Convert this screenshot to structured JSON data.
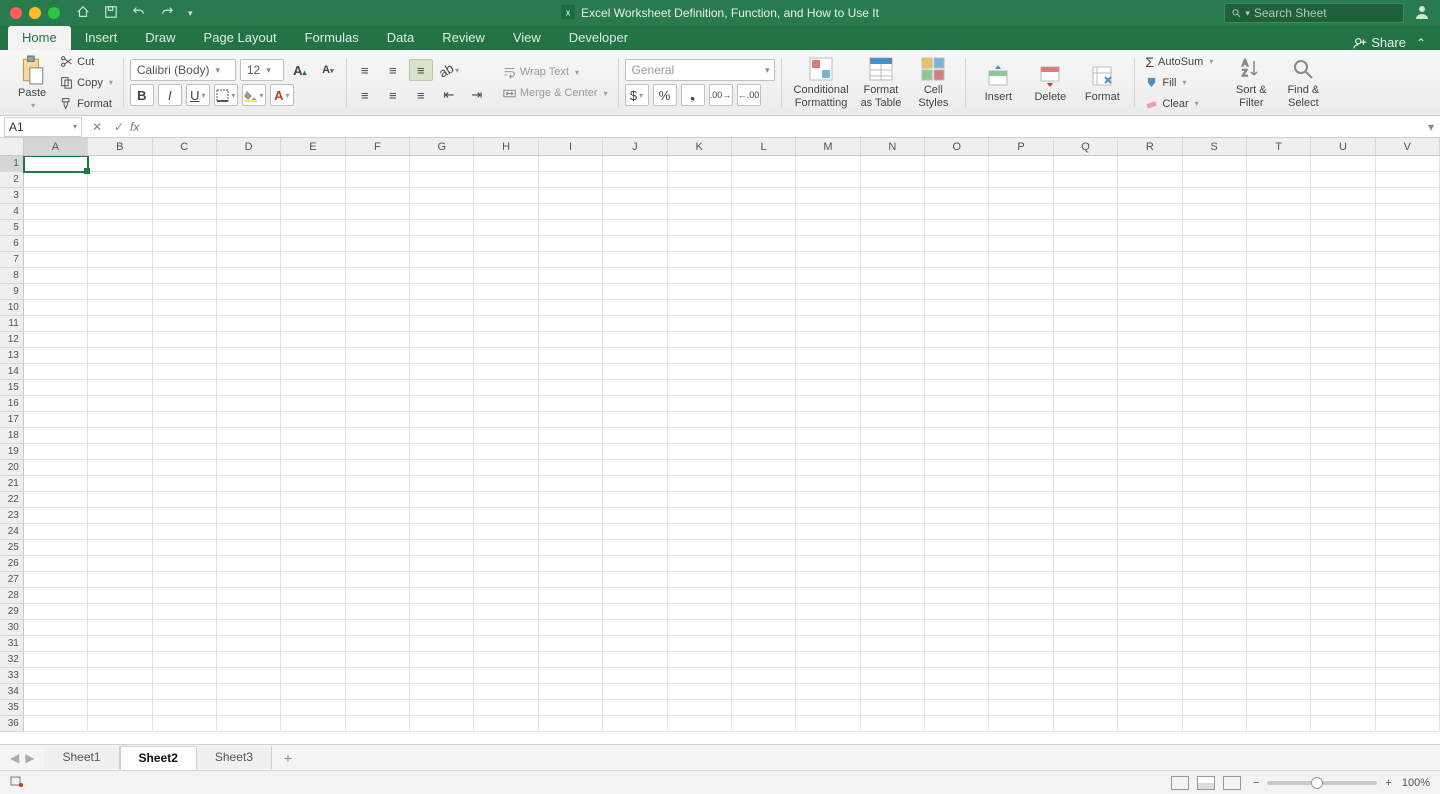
{
  "window_title": "Excel Worksheet Definition, Function, and How to Use It",
  "search_placeholder": "Search Sheet",
  "tabs": [
    "Home",
    "Insert",
    "Draw",
    "Page Layout",
    "Formulas",
    "Data",
    "Review",
    "View",
    "Developer"
  ],
  "active_tab": "Home",
  "share_label": "Share",
  "clipboard": {
    "paste": "Paste",
    "cut": "Cut",
    "copy": "Copy",
    "format": "Format"
  },
  "font": {
    "name": "Calibri (Body)",
    "size": "12"
  },
  "alignment": {
    "wrap": "Wrap Text",
    "merge": "Merge & Center"
  },
  "number_format": "General",
  "styles": {
    "conditional": "Conditional\nFormatting",
    "table": "Format\nas Table",
    "cell": "Cell\nStyles"
  },
  "cells": {
    "insert": "Insert",
    "delete": "Delete",
    "format": "Format"
  },
  "editing": {
    "autosum": "AutoSum",
    "fill": "Fill",
    "clear": "Clear",
    "sort": "Sort &\nFilter",
    "find": "Find &\nSelect"
  },
  "name_box": "A1",
  "columns": [
    "A",
    "B",
    "C",
    "D",
    "E",
    "F",
    "G",
    "H",
    "I",
    "J",
    "K",
    "L",
    "M",
    "N",
    "O",
    "P",
    "Q",
    "R",
    "S",
    "T",
    "U",
    "V"
  ],
  "row_count": 36,
  "active_cell": {
    "row": 1,
    "col": "A"
  },
  "sheets": [
    "Sheet1",
    "Sheet2",
    "Sheet3"
  ],
  "active_sheet": "Sheet2",
  "zoom": "100%"
}
